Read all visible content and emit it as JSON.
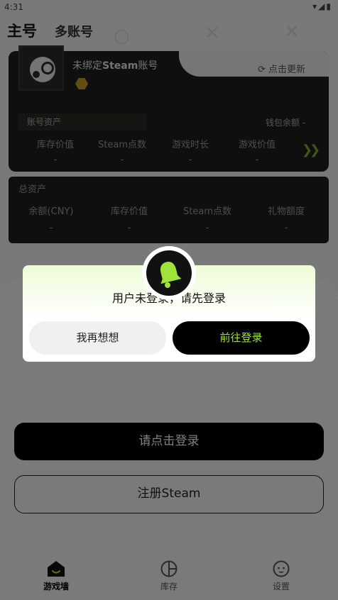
{
  "status_bar": {
    "time": "4:31",
    "icons": [
      "wifi-icon",
      "signal-icon",
      "battery-icon"
    ]
  },
  "top_nav": {
    "main_tab": "主号",
    "multi_tab": "多账号"
  },
  "account_card": {
    "unbound_prefix": "未绑定",
    "unbound_brand": "Steam",
    "unbound_suffix": "账号",
    "refresh_label": "点击更新",
    "asset_label": "账号资产",
    "wallet_label": "钱包余额 -",
    "metrics": [
      {
        "label": "库存价值",
        "value": "-"
      },
      {
        "label": "Steam点数",
        "value": "-"
      },
      {
        "label": "游戏时长",
        "value": "-"
      },
      {
        "label": "游戏价值",
        "value": "-"
      }
    ]
  },
  "total_card": {
    "label": "总资产",
    "metrics": [
      {
        "label": "余额(CNY)",
        "value": "-"
      },
      {
        "label": "库存价值",
        "value": "-"
      },
      {
        "label": "Steam点数",
        "value": "-"
      },
      {
        "label": "礼物额度",
        "value": "-"
      }
    ]
  },
  "sheet": {
    "login_label": "请点击登录",
    "register_label": "注册Steam"
  },
  "bottom_tabs": [
    {
      "label": "游戏墙",
      "icon": "house-icon",
      "active": true
    },
    {
      "label": "库存",
      "icon": "library-icon",
      "active": false
    },
    {
      "label": "设置",
      "icon": "settings-icon",
      "active": false
    }
  ],
  "dialog": {
    "message": "用户未登录，请先登录",
    "cancel_label": "我再想想",
    "confirm_label": "前往登录",
    "icon": "bell-icon",
    "accent_color": "#9fe33a"
  }
}
